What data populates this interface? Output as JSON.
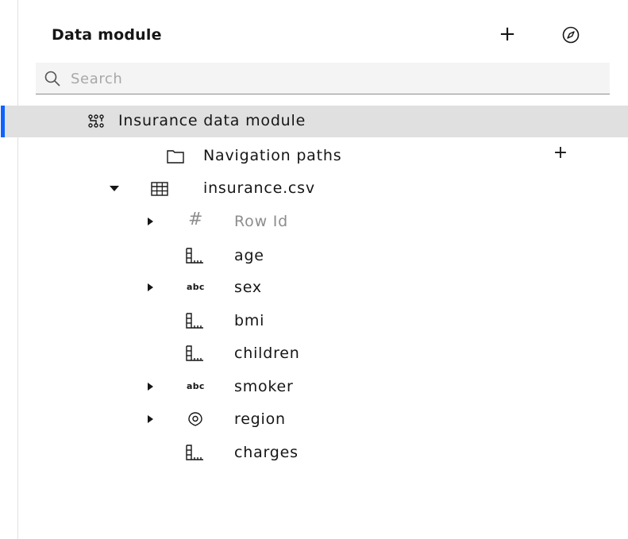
{
  "header": {
    "title": "Data module",
    "add_icon": "plus-icon",
    "compass_icon": "compass-icon"
  },
  "search": {
    "placeholder": "Search",
    "value": "",
    "icon": "search-icon"
  },
  "tree": {
    "root": {
      "label": "Insurance data module",
      "icon": "data-module-icon",
      "selected": true
    },
    "navigation_paths": {
      "label": "Navigation paths",
      "icon": "folder-icon",
      "add_icon": "plus-icon"
    },
    "table": {
      "label": "insurance.csv",
      "icon": "table-icon",
      "expanded": true
    },
    "columns": [
      {
        "label": "Row Id",
        "icon": "identifier-icon",
        "expandable": true,
        "muted": true
      },
      {
        "label": "age",
        "icon": "measure-icon",
        "expandable": false
      },
      {
        "label": "sex",
        "icon": "text-attribute-icon",
        "expandable": true
      },
      {
        "label": "bmi",
        "icon": "measure-icon",
        "expandable": false
      },
      {
        "label": "children",
        "icon": "measure-icon",
        "expandable": false
      },
      {
        "label": "smoker",
        "icon": "text-attribute-icon",
        "expandable": true
      },
      {
        "label": "region",
        "icon": "location-icon",
        "expandable": true
      },
      {
        "label": "charges",
        "icon": "measure-icon",
        "expandable": false
      }
    ],
    "abc_text": "abc",
    "hash_text": "#"
  },
  "colors": {
    "accent": "#0f62fe",
    "selected_bg": "#e0e0e0",
    "search_bg": "#f4f4f4",
    "muted_text": "#8d8d8d"
  }
}
